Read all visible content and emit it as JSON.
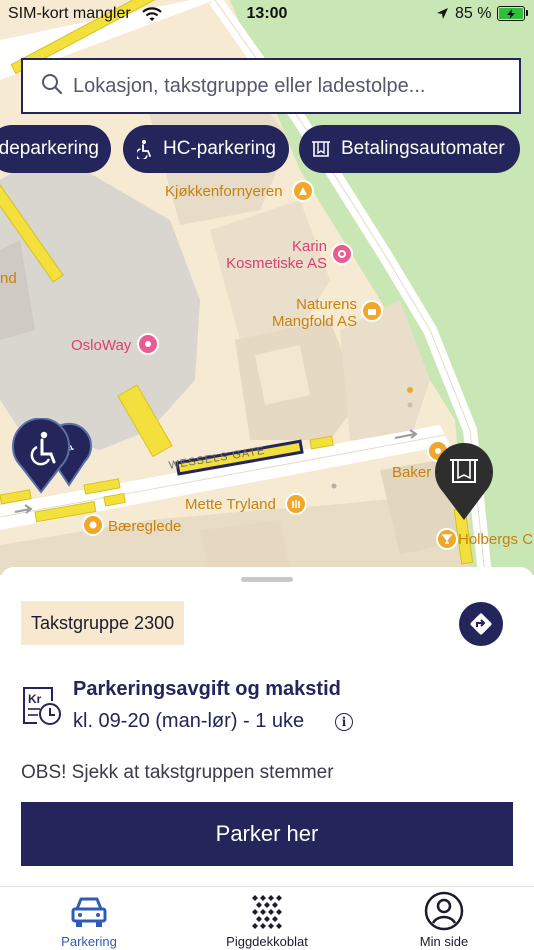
{
  "status_bar": {
    "carrier": "SIM-kort mangler",
    "time": "13:00",
    "battery_percent": "85 %",
    "icons": [
      "wifi-icon",
      "location-arrow-icon",
      "battery-charging-icon"
    ]
  },
  "search": {
    "placeholder": "Lokasjon, takstgruppe eller ladestolpe...",
    "icon": "search-icon"
  },
  "filter_chips": [
    {
      "label": "deparkering",
      "icon": null
    },
    {
      "label": "HC-parkering",
      "icon": "wheelchair-icon"
    },
    {
      "label": "Betalingsautomater",
      "icon": "ticket-machine-icon"
    }
  ],
  "map": {
    "street": "WESSELS GATE",
    "pois": [
      {
        "name": "Kjøkkenfornyeren",
        "category": "shop"
      },
      {
        "name": "Karin\nKosmetiske AS",
        "category": "health"
      },
      {
        "name": "Naturens\nMangfold AS",
        "category": "shop"
      },
      {
        "name": "OsloWay",
        "category": "health"
      },
      {
        "name": "Baker",
        "category": "food"
      },
      {
        "name": "Mette Tryland",
        "category": "shop"
      },
      {
        "name": "Bæreglede",
        "category": "shop"
      },
      {
        "name": "Holbergs C",
        "category": "bar"
      },
      {
        "name": "nd",
        "category": "shop"
      }
    ],
    "colors": {
      "ground": "#f6ead2",
      "park": "#c9e7b4",
      "building": "#e6dbc7",
      "parking_zone": "#f4e03c",
      "active_zone": "#24255a"
    }
  },
  "sheet": {
    "zone_tag": "Takstgruppe 2300",
    "fee_title": "Parkeringsavgift og makstid",
    "fee_detail": "kl. 09-20 (man-lør) - 1 uke",
    "warning": "OBS! Sjekk at takstgruppen stemmer",
    "cta_label": "Parker her"
  },
  "tabs": [
    {
      "label": "Parkering",
      "icon": "car-icon",
      "active": true
    },
    {
      "label": "Piggdekkoblat",
      "icon": "studded-tire-icon",
      "active": false
    },
    {
      "label": "Min side",
      "icon": "profile-icon",
      "active": false
    }
  ],
  "theme": {
    "primary": "#24255a",
    "active_tab": "#2f5bb8",
    "tag_bg": "#f7e8cf"
  }
}
